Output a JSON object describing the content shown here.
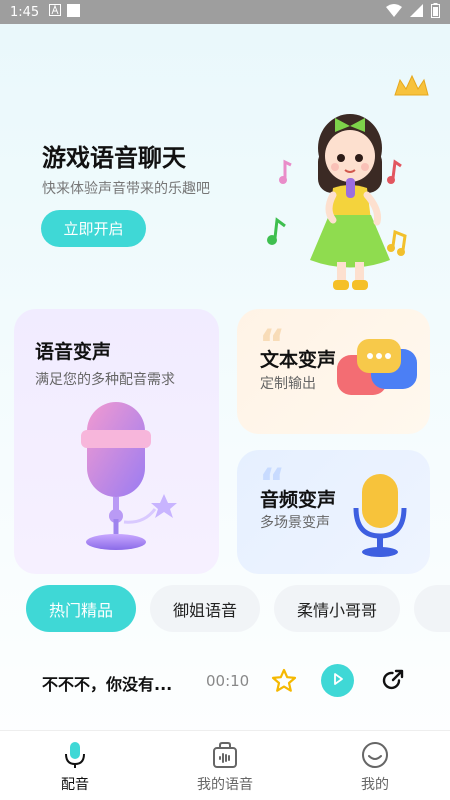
{
  "status_bar": {
    "time": "1:45"
  },
  "hero": {
    "title": "游戏语音聊天",
    "subtitle": "快来体验声音带来的乐趣吧",
    "button_label": "立即开启"
  },
  "cards": {
    "voice_change": {
      "title": "语音变声",
      "subtitle": "满足您的多种配音需求"
    },
    "text_change": {
      "title": "文本变声",
      "subtitle": "定制输出"
    },
    "audio_change": {
      "title": "音频变声",
      "subtitle": "多场景变声"
    }
  },
  "tabs": [
    {
      "label": "热门精品",
      "active": true
    },
    {
      "label": "御姐语音",
      "active": false
    },
    {
      "label": "柔情小哥哥",
      "active": false
    }
  ],
  "list": [
    {
      "title": "不不不，你没有...",
      "duration": "00:10"
    }
  ],
  "bottom_nav": [
    {
      "label": "配音",
      "icon": "microphone-icon",
      "active": true
    },
    {
      "label": "我的语音",
      "icon": "voice-bag-icon",
      "active": false
    },
    {
      "label": "我的",
      "icon": "smile-face-icon",
      "active": false
    }
  ],
  "colors": {
    "accent": "#3fd8d6",
    "voice_card_bg": "#f1ecff",
    "text_card_bg": "#fff3e6",
    "audio_card_bg": "#e6f0ff",
    "star": "#f5b800"
  }
}
